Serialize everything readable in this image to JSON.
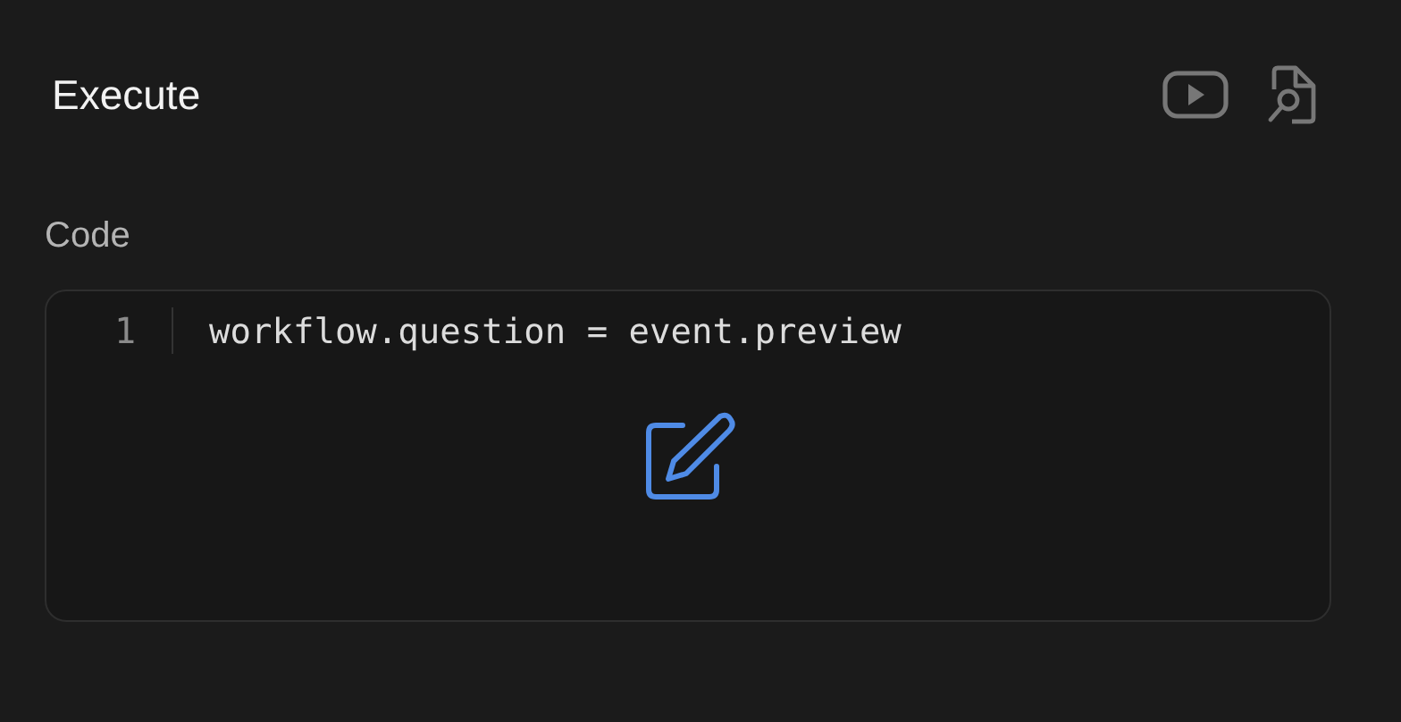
{
  "header": {
    "title": "Execute"
  },
  "code_field": {
    "label": "Code",
    "lines": [
      {
        "number": "1",
        "text": "workflow.question = event.preview"
      }
    ]
  }
}
